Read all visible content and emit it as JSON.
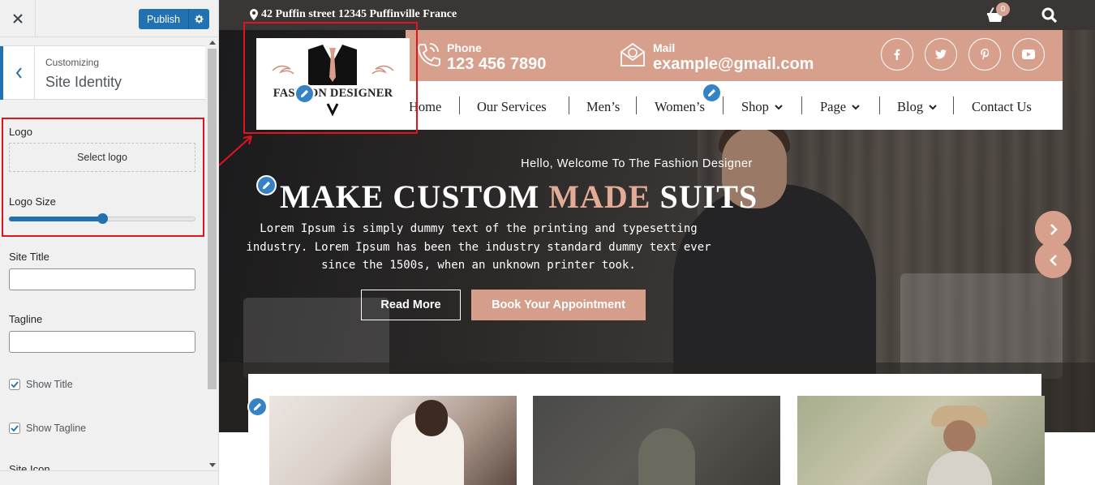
{
  "sidebar": {
    "close_icon": "close-icon",
    "publish_label": "Publish",
    "customizing_label": "Customizing",
    "section_title": "Site Identity",
    "logo": {
      "label": "Logo",
      "select_label": "Select logo"
    },
    "logo_size": {
      "label": "Logo Size",
      "value": 0.5
    },
    "site_title": {
      "label": "Site Title",
      "value": ""
    },
    "tagline": {
      "label": "Tagline",
      "value": ""
    },
    "show_title": {
      "label": "Show Title",
      "checked": true
    },
    "show_tagline": {
      "label": "Show Tagline",
      "checked": true
    },
    "site_icon_label": "Site Icon"
  },
  "preview": {
    "topbar": {
      "address": "42 Puffin street 12345 Puffinville France",
      "cart_count": "0"
    },
    "logo_text": "FASHION DESIGNER",
    "contact": {
      "phone_label": "Phone",
      "phone_value": "123 456 7890",
      "mail_label": "Mail",
      "mail_value": "example@gmail.com"
    },
    "social": [
      "facebook-icon",
      "twitter-icon",
      "pinterest-icon",
      "youtube-icon"
    ],
    "nav": [
      {
        "label": "Home",
        "dropdown": false
      },
      {
        "label": "Our Services",
        "dropdown": false
      },
      {
        "label": "Men’s",
        "dropdown": false
      },
      {
        "label": "Women’s",
        "dropdown": false
      },
      {
        "label": "Shop",
        "dropdown": true
      },
      {
        "label": "Page",
        "dropdown": true
      },
      {
        "label": "Blog",
        "dropdown": true
      },
      {
        "label": "Contact Us",
        "dropdown": false
      }
    ],
    "hero": {
      "greeting": "Hello, Welcome To The Fashion Designer",
      "heading_part1": "MAKE CUSTOM ",
      "heading_accent": "MADE",
      "heading_part2": " SUITS",
      "description": "Lorem Ipsum is simply dummy text of the printing and typesetting industry. Lorem Ipsum has been the industry standard dummy text ever since the 1500s, when an unknown printer took.",
      "read_more": "Read More",
      "book": "Book Your Appointment"
    }
  },
  "colors": {
    "accent": "#d7a08c",
    "wp_blue": "#2271b1",
    "topbar": "#3a3635",
    "highlight_red": "#e0141c"
  }
}
